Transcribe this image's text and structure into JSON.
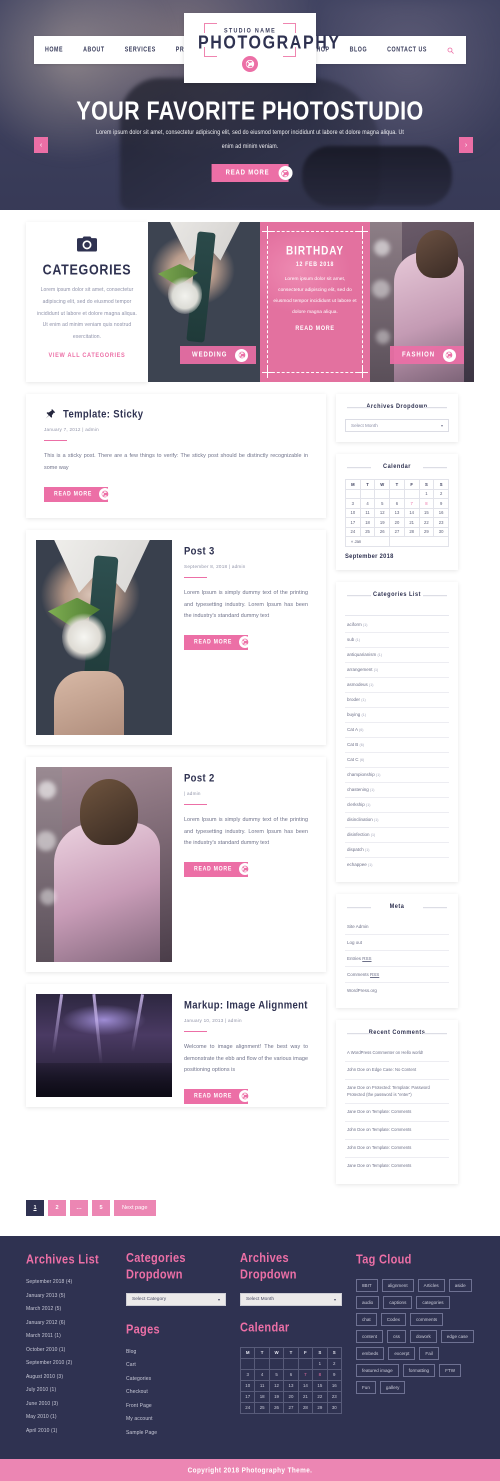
{
  "header": {
    "logo": {
      "studio": "STUDIO NAME",
      "name": "PHOTOGRAPHY",
      "aperture_icon": "aperture-icon"
    },
    "nav_left": [
      "HOME",
      "ABOUT",
      "SERVICES",
      "PROJECT"
    ],
    "nav_right": [
      "SHOP",
      "BLOG",
      "CONTACT US"
    ],
    "search_icon": "search-icon"
  },
  "hero": {
    "title": "YOUR FAVORITE PHOTOSTUDIO",
    "subtitle": "Lorem ipsum dolor sit amet, consectetur adipiscing elit, sed do eiusmod tempor incididunt ut labore et dolore magna aliqua. Ut enim ad minim veniam.",
    "button": "READ MORE",
    "prev": "‹",
    "next": "›"
  },
  "categories": {
    "camera_icon": "camera-icon",
    "title": "CATEGORIES",
    "text": "Lorem ipsum dolor sit amet, consectetur adipiscing elit, sed do eiusmod tempor incididunt ut labore et dolore magna aliqua. Ut enim ad minim veniam quis nostrud exercitation.",
    "link": "VIEW ALL CATEGORIES",
    "tiles": [
      {
        "label": "WEDDING"
      },
      {
        "label": "BIRTHDAY",
        "date": "12 FEB 2018",
        "text": "Lorem ipsum dolor sit amet, consectetur adipiscing elit, sed do eiusmod tempor incididunt ut labore et dolore magna aliqua.",
        "read_more": "READ MORE"
      },
      {
        "label": "FASHION"
      }
    ]
  },
  "posts": [
    {
      "title": "Template: Sticky",
      "meta": "January 7, 2012 |  admin",
      "excerpt": "This is a sticky post. There are a few things to verify: The sticky post should be distinctly recognizable in some way",
      "button": "READ MORE",
      "pin_icon": "pin-icon"
    },
    {
      "title": "Post 3",
      "meta": "September 8, 2018 |  admin",
      "excerpt": "Lorem Ipsum is simply dummy text of the printing and typesetting industry. Lorem Ipsum has been the industry's standard dummy text",
      "button": "READ MORE"
    },
    {
      "title": "Post 2",
      "meta": "|  admin",
      "excerpt": "Lorem Ipsum is simply dummy text of the printing and typesetting industry. Lorem Ipsum has been the industry's standard dummy text",
      "button": "READ MORE"
    },
    {
      "title": "Markup: Image Alignment",
      "meta": "January 10, 2013 |  admin",
      "excerpt": "Welcome to image alignment! The best way to demonstrate the ebb and flow of the various image positioning options is",
      "button": "READ MORE"
    }
  ],
  "pagination": [
    "1",
    "2",
    "…",
    "5",
    "Next page"
  ],
  "sidebar": {
    "archives_dropdown": {
      "title": "Archives Dropdown",
      "select_value": "Select Month"
    },
    "calendar": {
      "title": "Calendar",
      "headers": [
        "M",
        "T",
        "W",
        "T",
        "F",
        "S",
        "S"
      ],
      "weeks": [
        [
          "",
          "",
          "",
          "",
          "",
          "1",
          "2"
        ],
        [
          "3",
          "4",
          "5",
          "6",
          "7",
          "8",
          "9"
        ],
        [
          "10",
          "11",
          "12",
          "13",
          "14",
          "15",
          "16"
        ],
        [
          "17",
          "18",
          "19",
          "20",
          "21",
          "22",
          "23"
        ],
        [
          "24",
          "25",
          "26",
          "27",
          "28",
          "29",
          "30"
        ]
      ],
      "links": [
        "7",
        "8"
      ],
      "prev_nav": "« Jan",
      "caption": "September 2018"
    },
    "categories_list": {
      "title": "Categories List",
      "items": [
        {
          "label": "aciform",
          "count": "(1)"
        },
        {
          "label": "sub",
          "count": "(1)"
        },
        {
          "label": "antiquarianism",
          "count": "(1)"
        },
        {
          "label": "arrangement",
          "count": "(1)"
        },
        {
          "label": "asmodeus",
          "count": "(1)"
        },
        {
          "label": "broder",
          "count": "(1)"
        },
        {
          "label": "buying",
          "count": "(1)"
        },
        {
          "label": "Cat A",
          "count": "(6)"
        },
        {
          "label": "Cat B",
          "count": "(6)"
        },
        {
          "label": "Cat C",
          "count": "(6)"
        },
        {
          "label": "championship",
          "count": "(1)"
        },
        {
          "label": "chastening",
          "count": "(1)"
        },
        {
          "label": "clerkship",
          "count": "(1)"
        },
        {
          "label": "disinclination",
          "count": "(1)"
        },
        {
          "label": "disinfection",
          "count": "(1)"
        },
        {
          "label": "dispatch",
          "count": "(1)"
        },
        {
          "label": "echappee",
          "count": "(1)"
        }
      ]
    },
    "meta": {
      "title": "Meta",
      "items": [
        "Site Admin",
        "Log out",
        "Entries RSS",
        "Comments RSS",
        "WordPress.org"
      ]
    },
    "recent_comments": {
      "title": "Recent Comments",
      "items": [
        "A WordPress Commenter on Hello world!",
        "John Doe on Edge Case: No Content",
        "Jane Doe on Protected: Template: Password Protected (the password is \"enter\")",
        "Jane Doe on Template: Comments",
        "John Doe on Template: Comments",
        "John Doe on Template: Comments",
        "Jane Doe on Template: Comments"
      ]
    }
  },
  "footer": {
    "archives_list": {
      "title": "Archives List",
      "items": [
        "September 2018 (4)",
        "January 2013 (5)",
        "March 2012 (5)",
        "January 2012 (6)",
        "March 2011 (1)",
        "October 2010 (1)",
        "September 2010 (2)",
        "August 2010 (3)",
        "July 2010 (1)",
        "June 2010 (3)",
        "May 2010 (1)",
        "April 2010 (1)"
      ]
    },
    "categories_dropdown": {
      "title": "Categories Dropdown",
      "select_value": "Select Category"
    },
    "pages": {
      "title": "Pages",
      "items": [
        "Blog",
        "Cart",
        "Categories",
        "Checkout",
        "Front Page",
        "My account",
        "Sample Page"
      ]
    },
    "archives_dropdown": {
      "title": "Archives Dropdown",
      "select_value": "Select Month"
    },
    "calendar": {
      "title": "Calendar",
      "headers": [
        "M",
        "T",
        "W",
        "T",
        "F",
        "S",
        "S"
      ],
      "weeks": [
        [
          "",
          "",
          "",
          "",
          "",
          "1",
          "2"
        ],
        [
          "3",
          "4",
          "5",
          "6",
          "7",
          "8",
          "9"
        ],
        [
          "10",
          "11",
          "12",
          "13",
          "14",
          "15",
          "16"
        ],
        [
          "17",
          "18",
          "19",
          "20",
          "21",
          "22",
          "23"
        ],
        [
          "24",
          "25",
          "26",
          "27",
          "28",
          "29",
          "30"
        ]
      ],
      "links": [
        "7",
        "8"
      ]
    },
    "tag_cloud": {
      "title": "Tag Cloud",
      "tags": [
        "8BIT",
        "alignment",
        "Articles",
        "aside",
        "audio",
        "captions",
        "categories",
        "chat",
        "Codex",
        "comments",
        "content",
        "css",
        "dowork",
        "edge case",
        "embeds",
        "excerpt",
        "Fail",
        "featured image",
        "formatting",
        "FTW",
        "Fun",
        "gallery"
      ]
    },
    "copyright": "Copyright 2018 Photography Theme."
  },
  "colors": {
    "accent": "#ec6fa6",
    "accent_light": "#ec86b3",
    "dark": "#2f3251",
    "text": "#6e7189"
  }
}
